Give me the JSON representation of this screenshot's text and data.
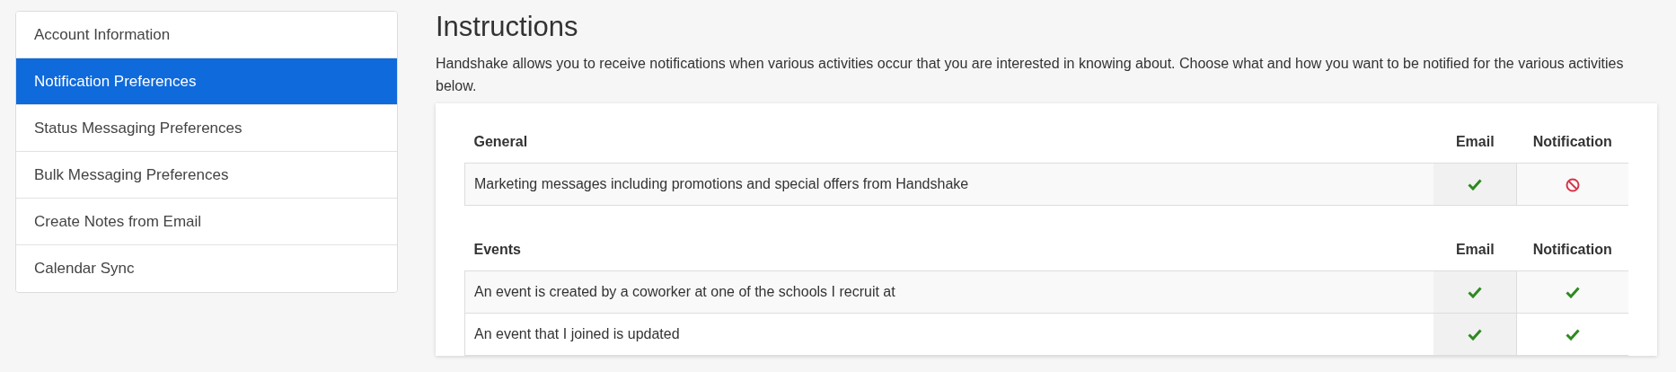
{
  "sidebar": {
    "items": [
      {
        "label": "Account Information",
        "selected": false
      },
      {
        "label": "Notification Preferences",
        "selected": true
      },
      {
        "label": "Status Messaging Preferences",
        "selected": false
      },
      {
        "label": "Bulk Messaging Preferences",
        "selected": false
      },
      {
        "label": "Create Notes from Email",
        "selected": false
      },
      {
        "label": "Calendar Sync",
        "selected": false
      }
    ]
  },
  "main": {
    "title": "Instructions",
    "description": "Handshake allows you to receive notifications when various activities occur that you are interested in knowing about. Choose what and how you want to be notified for the various activities below.",
    "sections": [
      {
        "heading": "General",
        "columns": [
          "Email",
          "Notification"
        ],
        "rows": [
          {
            "label": "Marketing messages including promotions and special offers from Handshake",
            "email": true,
            "notification": false
          }
        ]
      },
      {
        "heading": "Events",
        "columns": [
          "Email",
          "Notification"
        ],
        "rows": [
          {
            "label": "An event is created by a coworker at one of the schools I recruit at",
            "email": true,
            "notification": true
          },
          {
            "label": "An event that I joined is updated",
            "email": true,
            "notification": true
          }
        ]
      }
    ]
  }
}
